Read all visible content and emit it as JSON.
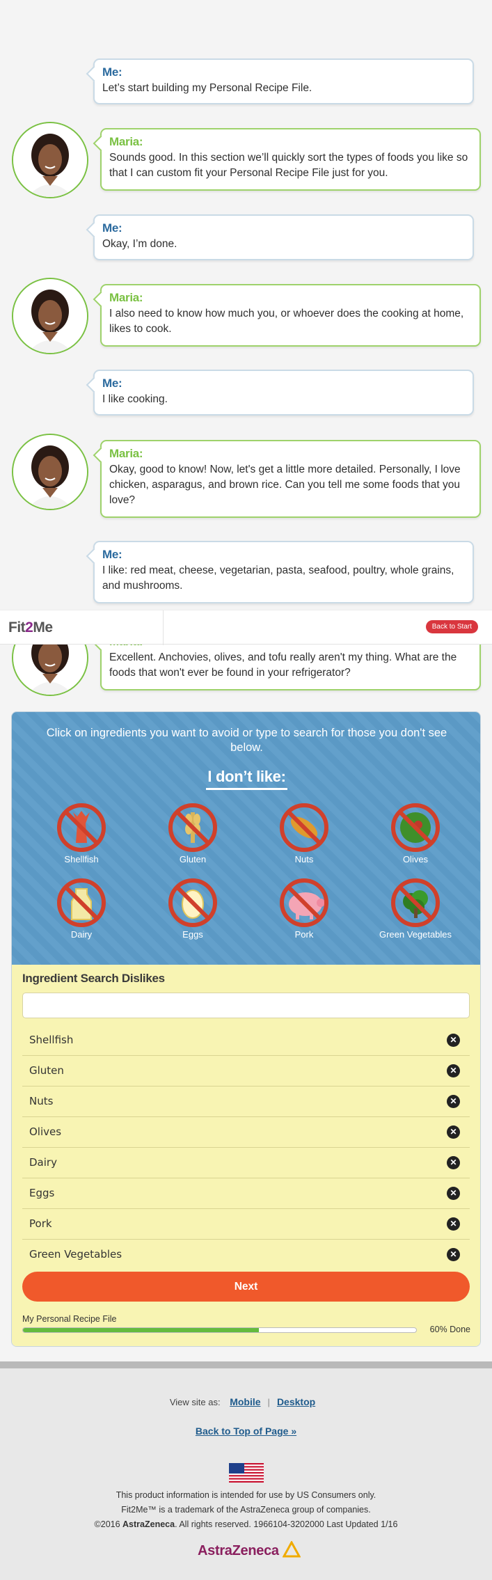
{
  "chat": [
    {
      "speaker": "Me:",
      "text": "Let’s start building my Personal Recipe File."
    },
    {
      "speaker": "Maria:",
      "text": "Sounds good. In this section we’ll quickly sort the types of foods you like so that I can custom fit your Personal Recipe File just for you."
    },
    {
      "speaker": "Me:",
      "text": "Okay, I’m done."
    },
    {
      "speaker": "Maria:",
      "text": "I also need to know how much you, or whoever does the cooking at home, likes to cook."
    },
    {
      "speaker": "Me:",
      "text": "I like cooking."
    },
    {
      "speaker": "Maria:",
      "text": "Okay, good to know! Now, let's get a little more detailed. Personally, I love chicken, asparagus, and brown rice. Can you tell me some foods that you love?"
    },
    {
      "speaker": "Me:",
      "text": "I like: red meat, cheese, vegetarian, pasta, seafood, poultry, whole grains, and mushrooms."
    },
    {
      "speaker": "Maria:",
      "text": "Excellent. Anchovies, olives, and tofu really aren't my thing. What are the foods that won't ever be found in your refrigerator?"
    }
  ],
  "header": {
    "logo_prefix": "Fit",
    "logo_two": "2",
    "logo_suffix": "Me",
    "back_to_start": "Back to Start"
  },
  "dislikes": {
    "instruction": "Click on ingredients you want to avoid or type to search for those you don't see below.",
    "title": "I don’t like:",
    "tiles": [
      {
        "label": "Shellfish",
        "icon": "shellfish-icon"
      },
      {
        "label": "Gluten",
        "icon": "gluten-icon"
      },
      {
        "label": "Nuts",
        "icon": "nuts-icon"
      },
      {
        "label": "Olives",
        "icon": "olives-icon"
      },
      {
        "label": "Dairy",
        "icon": "dairy-icon"
      },
      {
        "label": "Eggs",
        "icon": "eggs-icon"
      },
      {
        "label": "Pork",
        "icon": "pork-icon"
      },
      {
        "label": "Green Vegetables",
        "icon": "green-vegetables-icon"
      }
    ]
  },
  "search": {
    "title": "Ingredient Search Dislikes",
    "value": "",
    "placeholder": ""
  },
  "selected": [
    "Shellfish",
    "Gluten",
    "Nuts",
    "Olives",
    "Dairy",
    "Eggs",
    "Pork",
    "Green Vegetables"
  ],
  "next_label": "Next",
  "progress": {
    "label": "My Personal Recipe File",
    "percent": 60,
    "done_text": "60% Done"
  },
  "footer": {
    "view_as": "View site as:",
    "mobile": "Mobile",
    "separator": "|",
    "desktop": "Desktop",
    "back_to_top": "Back to Top of Page »",
    "legal1": "This product information is intended for use by US Consumers only.",
    "legal2": "Fit2Me™ is a trademark of the AstraZeneca group of companies.",
    "legal3_pre": "©2016 ",
    "legal3_brand": "AstraZeneca",
    "legal3_post": ". All rights reserved. 1966104-3202000 Last Updated 1/16",
    "company_logo": "AstraZeneca"
  },
  "colors": {
    "me": "#2b6a9e",
    "maria": "#7ac143",
    "next": "#f0592b",
    "progress": "#64bb3d",
    "panel_blue": "#5d9cc9",
    "panel_yellow": "#f8f4b3"
  }
}
